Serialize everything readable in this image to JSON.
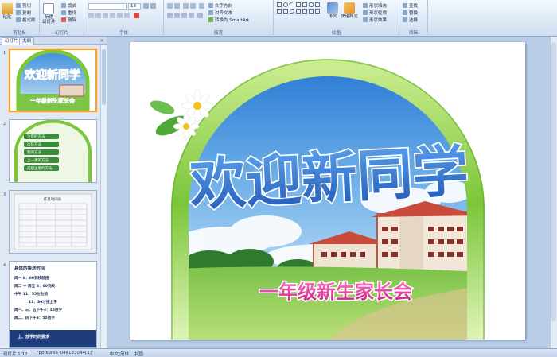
{
  "ribbon": {
    "clipboard": {
      "paste": "粘贴",
      "cut": "剪切",
      "copy": "复制",
      "format_painter": "格式刷",
      "label": "剪贴板"
    },
    "slides": {
      "new_slide": "新建",
      "new_slide_line2": "幻灯片",
      "layout": "版式",
      "reset": "重设",
      "delete": "删除",
      "label": "幻灯片"
    },
    "font": {
      "size": "18",
      "label": "字体"
    },
    "paragraph": {
      "text_direction": "文字方向",
      "align_text": "对齐文本",
      "smartart": "转换为 SmartArt",
      "label": "段落"
    },
    "drawing": {
      "arrange": "排列",
      "quick_styles": "快速样式",
      "shape_fill": "形状填充",
      "shape_outline": "形状轮廓",
      "shape_effects": "形状效果",
      "label": "绘图"
    },
    "editing": {
      "find": "查找",
      "replace": "替换",
      "select": "选择",
      "label": "编辑"
    }
  },
  "panel": {
    "tabs": [
      "幻灯片",
      "大纲"
    ],
    "close": "×",
    "slides": [
      {
        "num": "1",
        "title": "欢迎新同学",
        "subtitle": "一年级新生家长会"
      },
      {
        "num": "2",
        "items": [
          "注意的方法",
          "这些方法",
          "我的方法",
          "上一课的方法",
          "成绩注意的方法"
        ]
      },
      {
        "num": "3",
        "table_title": "作息时间表"
      },
      {
        "num": "4",
        "heading": "具体的接送时间",
        "lines": [
          "周一 8：00到校前接",
          "周二 — 周五 8：00到校",
          "中午 11：55左右前",
          "11：30才接上学",
          "周一、三、五下午3：15放学",
          "周二、四下午3：55放学"
        ],
        "footer": "上、放学时的要求"
      }
    ]
  },
  "slide": {
    "title": "欢迎新同学",
    "subtitle": "一年级新生家长会"
  },
  "status": {
    "slide_info": "幻灯片 1/12",
    "theme": "\"pptkorea_04e133044[1]\"",
    "language": "中文(简体，中国)"
  },
  "colors": {
    "title_fill": "#3f7fd6",
    "subtitle_fill": "#e63fa0",
    "arch_green": "#7cc63a",
    "ribbon_bg": "#dde8f6"
  }
}
